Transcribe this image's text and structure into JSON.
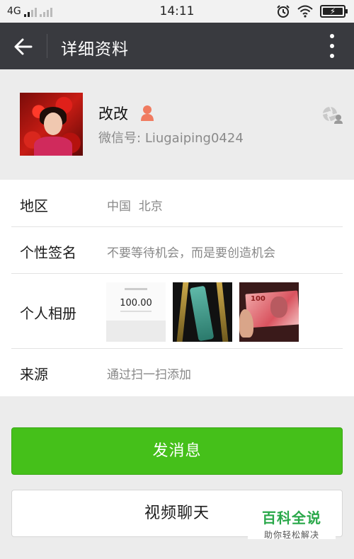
{
  "status_bar": {
    "network": "4G",
    "time": "14:11"
  },
  "app_bar": {
    "title": "详细资料"
  },
  "profile": {
    "name": "改改",
    "wechat_id_label": "微信号:",
    "wechat_id": "Liugaiping0424"
  },
  "info": {
    "region": {
      "label": "地区",
      "value": "中国  北京"
    },
    "signature": {
      "label": "个性签名",
      "value": "不要等待机会，而是要创造机会"
    },
    "album": {
      "label": "个人相册",
      "photos": [
        {
          "caption": "100.00"
        },
        {
          "caption": ""
        },
        {
          "caption": "100"
        }
      ]
    },
    "source": {
      "label": "来源",
      "value": "通过扫一扫添加"
    }
  },
  "actions": {
    "send_message": "发消息",
    "video_call": "视频聊天"
  },
  "watermark": {
    "brand": "百科全说",
    "tagline": "助你轻松解决"
  },
  "colors": {
    "app_bar": "#393a3f",
    "primary_button": "#45c01a",
    "gender_icon": "#f07b60",
    "watermark_green": "#2aa84a"
  }
}
